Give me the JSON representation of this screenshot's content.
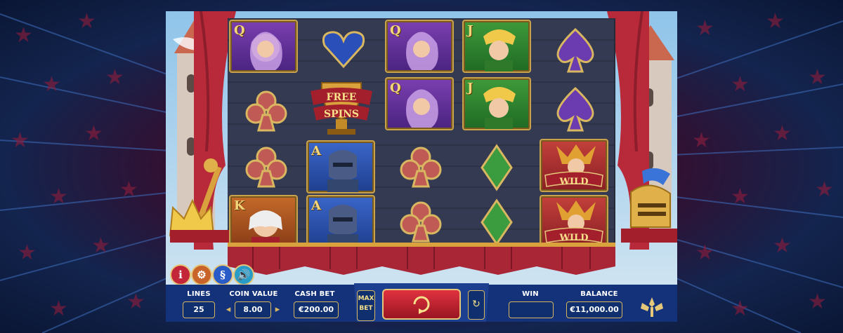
{
  "game": {
    "free_spins_line1": "FREE",
    "free_spins_line2": "SPINS",
    "wild_label": "WILD",
    "card_ranks": {
      "queen": "Q",
      "jack": "J",
      "ace": "A",
      "king": "K"
    }
  },
  "reels": [
    [
      "queen-symbol",
      "club-symbol",
      "club-symbol",
      "king-symbol"
    ],
    [
      "heart-symbol",
      "free-spins-symbol",
      "ace-symbol",
      "ace-symbol"
    ],
    [
      "queen-symbol",
      "queen-symbol",
      "club-symbol",
      "club-symbol"
    ],
    [
      "jack-symbol",
      "jack-symbol",
      "diamond-symbol",
      "diamond-symbol"
    ],
    [
      "spade-symbol",
      "spade-symbol",
      "wild-symbol",
      "wild-symbol"
    ]
  ],
  "controls": {
    "lines_label": "LINES",
    "lines_value": "25",
    "coin_value_label": "COIN VALUE",
    "coin_value": "8.00",
    "cash_bet_label": "CASH BET",
    "cash_bet_value": "€200.00",
    "max_bet_line1": "MAX",
    "max_bet_line2": "BET",
    "win_label": "WIN",
    "win_value": "",
    "balance_label": "BALANCE",
    "balance_value": "€11,000.00",
    "info_glyph": "i",
    "rules_glyph": "§"
  },
  "colors": {
    "panel_blue": "#0f2f6e",
    "gold": "#d9b660",
    "curtain_red": "#b82a3a",
    "stage_dark": "#343a52"
  }
}
